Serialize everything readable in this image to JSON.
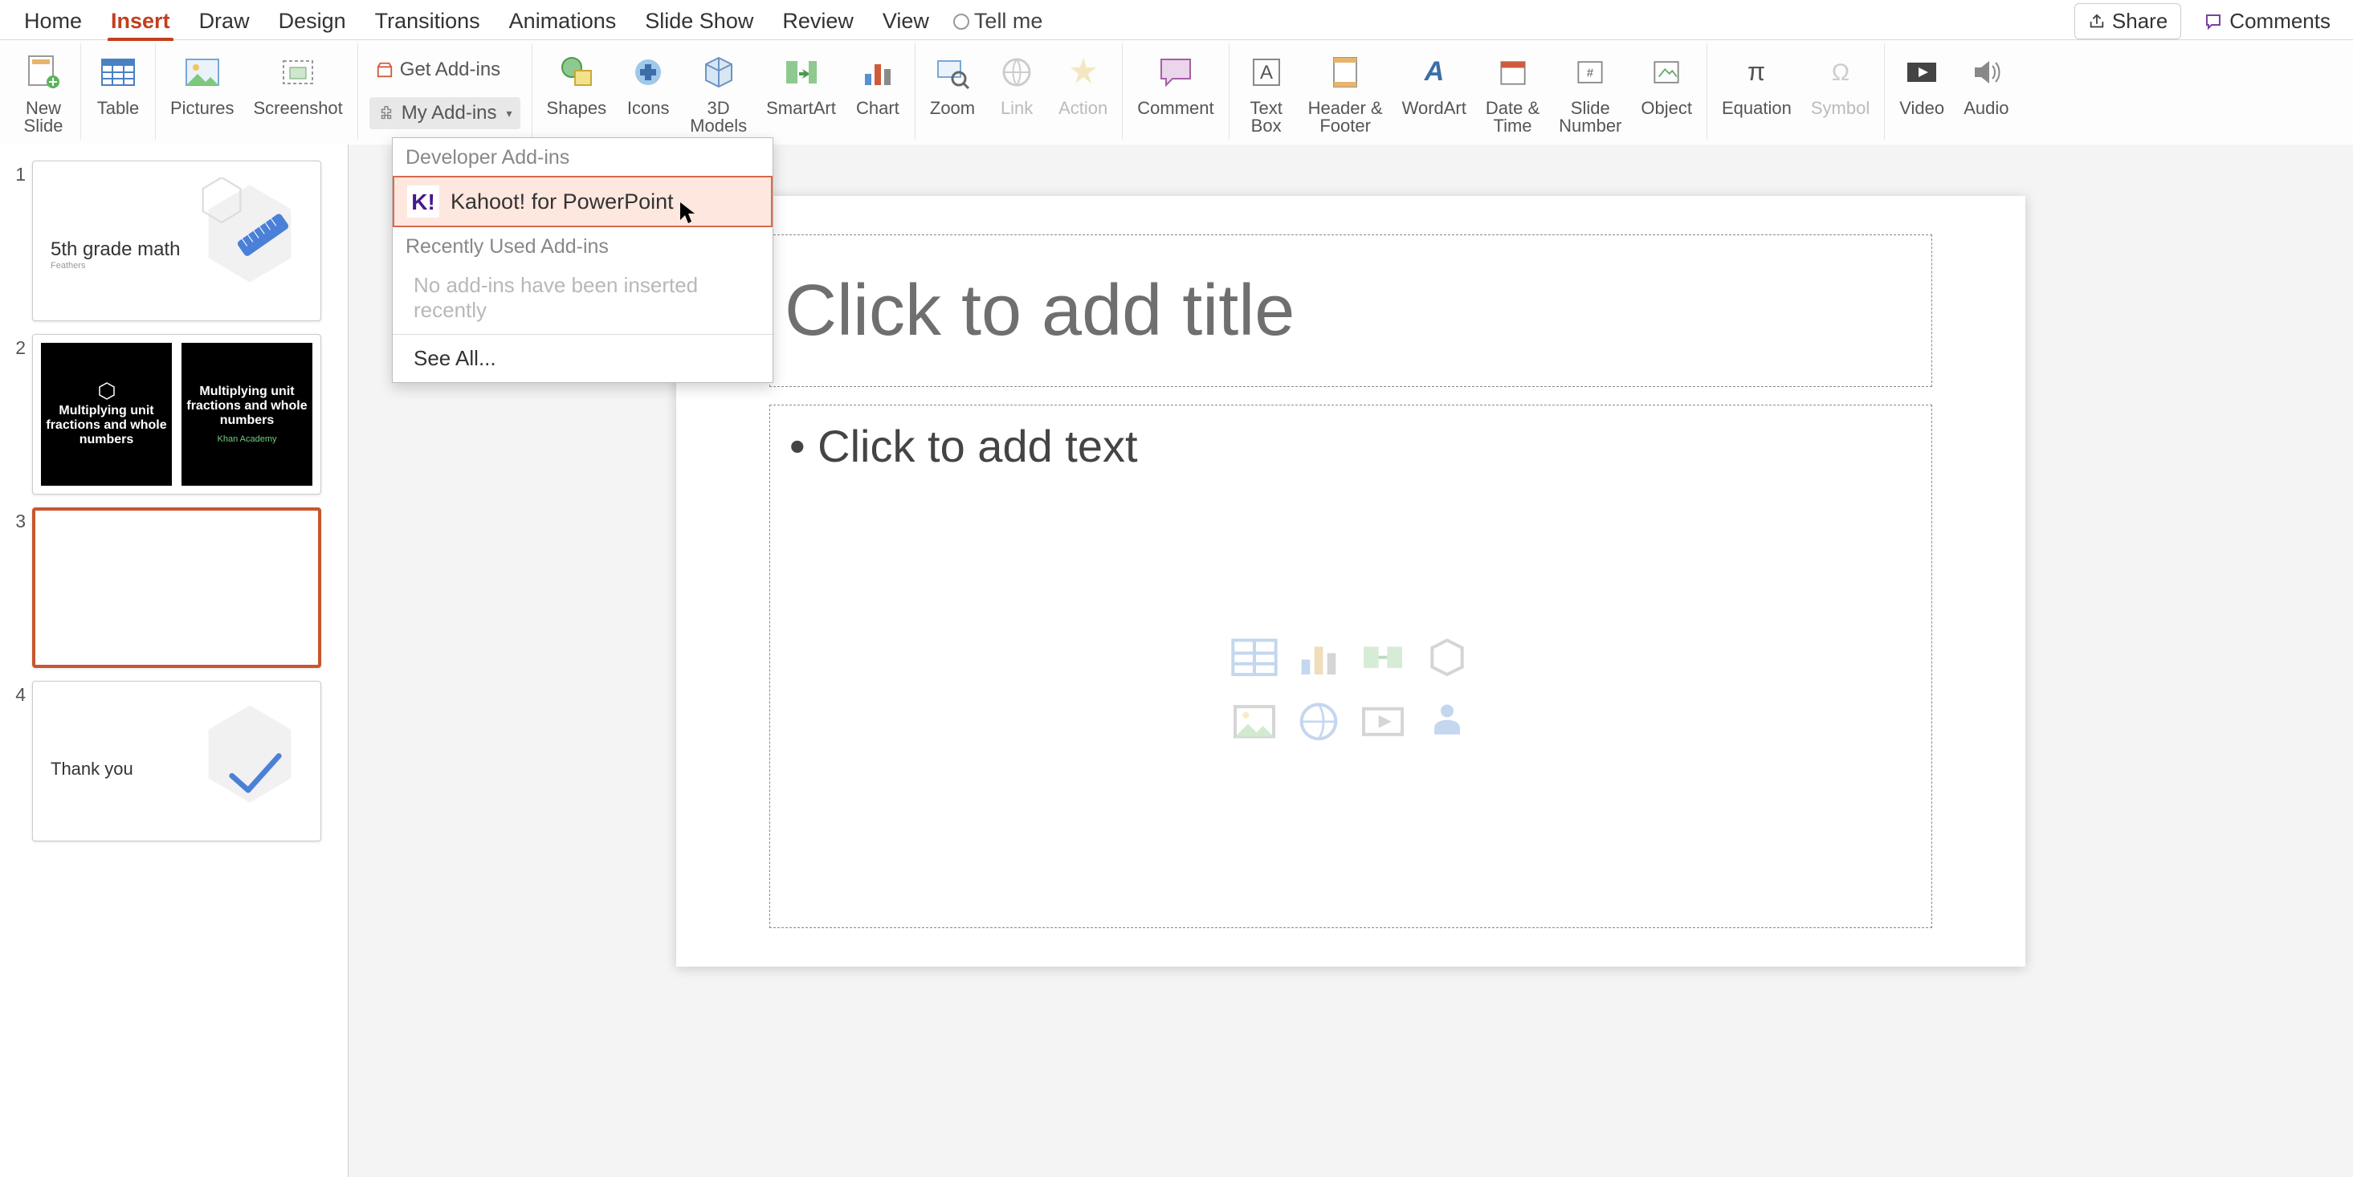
{
  "tabs": {
    "home": "Home",
    "insert": "Insert",
    "draw": "Draw",
    "design": "Design",
    "transitions": "Transitions",
    "animations": "Animations",
    "slideshow": "Slide Show",
    "review": "Review",
    "view": "View",
    "tellme": "Tell me"
  },
  "actions": {
    "share": "Share",
    "comments": "Comments"
  },
  "ribbon": {
    "new_slide": "New\nSlide",
    "table": "Table",
    "pictures": "Pictures",
    "screenshot": "Screenshot",
    "get_addins": "Get Add-ins",
    "my_addins": "My Add-ins",
    "shapes": "Shapes",
    "icons": "Icons",
    "models3d": "3D\nModels",
    "smartart": "SmartArt",
    "chart": "Chart",
    "zoom": "Zoom",
    "link": "Link",
    "action": "Action",
    "comment": "Comment",
    "textbox": "Text\nBox",
    "headerfooter": "Header &\nFooter",
    "wordart": "WordArt",
    "datetime": "Date &\nTime",
    "slidenumber": "Slide\nNumber",
    "object": "Object",
    "equation": "Equation",
    "symbol": "Symbol",
    "video": "Video",
    "audio": "Audio"
  },
  "popover": {
    "developer": "Developer Add-ins",
    "kahoot": "Kahoot! for PowerPoint",
    "recent": "Recently Used Add-ins",
    "none": "No add-ins have been inserted recently",
    "seeall": "See All..."
  },
  "slides": {
    "n1": "1",
    "n2": "2",
    "n3": "3",
    "n4": "4",
    "s1_title": "5th grade math",
    "s1_sub": "Feathers",
    "s2_left": "Multiplying unit fractions and whole numbers",
    "s2_right": "Multiplying unit fractions and whole numbers",
    "s2_foot": "Khan Academy",
    "s4_text": "Thank you"
  },
  "canvas": {
    "title_placeholder": "Click to add title",
    "body_placeholder": "• Click to add text"
  }
}
